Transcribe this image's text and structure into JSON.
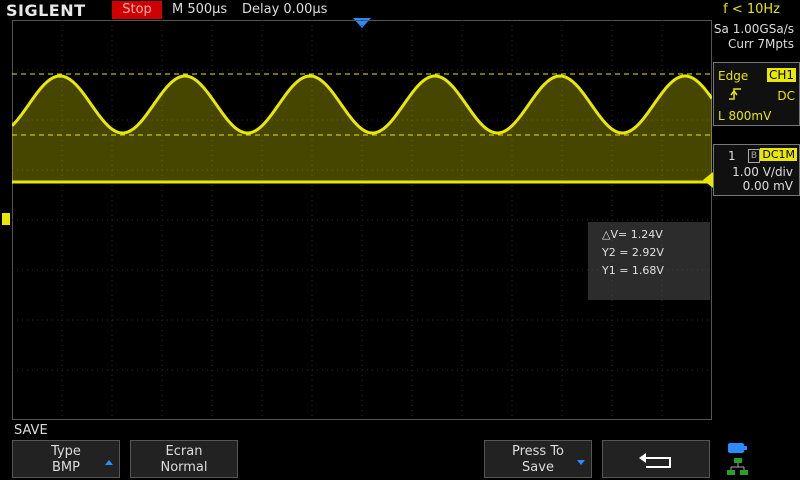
{
  "topbar": {
    "brand": "SIGLENT",
    "run_state": "Stop",
    "timebase": "M 500µs",
    "delay": "Delay 0.00µs",
    "freq": "f < 10Hz"
  },
  "acquisition": {
    "sample_rate": "Sa 1.00GSa/s",
    "memory": "Curr 7Mpts"
  },
  "trigger": {
    "type": "Edge",
    "source": "CH1",
    "slope_icon": "rising-edge-icon",
    "coupling": "DC",
    "level": "L  800mV"
  },
  "channel1": {
    "number": "1",
    "bw_icon_label": "B",
    "coupling": "DC1M",
    "volts_div": "1.00 V/div",
    "offset": "0.00 mV",
    "color": "#e8e800"
  },
  "cursors": {
    "delta_v": "△V= 1.24V",
    "y2": "Y2 = 2.92V",
    "y1": "Y1 = 1.68V"
  },
  "menu": {
    "title": "SAVE",
    "softkeys": [
      {
        "line1": "Type",
        "line2": "BMP"
      },
      {
        "line1": "Ecran",
        "line2": "Normal"
      },
      {
        "line1": "Press To",
        "line2": "Save"
      },
      {
        "icon": "return-arrow-icon"
      }
    ]
  },
  "waveform": {
    "cycles_visible": 5.6,
    "color": "#e8e800"
  }
}
